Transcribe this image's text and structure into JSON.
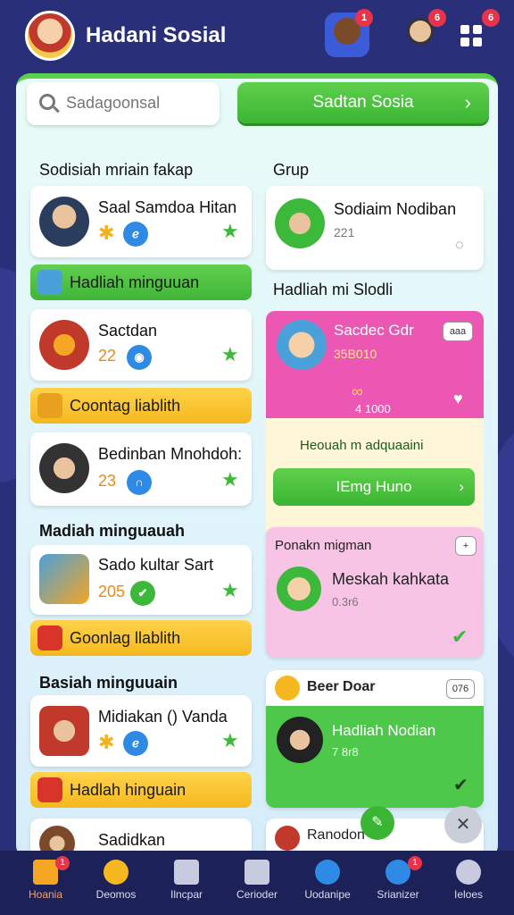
{
  "header": {
    "title": "Hadani Sosial",
    "icons": [
      {
        "name": "friends-icon",
        "badge": "1"
      },
      {
        "name": "profile-icon",
        "badge": "6"
      },
      {
        "name": "grid-menu-icon",
        "badge": "6"
      }
    ]
  },
  "search": {
    "placeholder": "Sadagoonsal"
  },
  "primary_button": {
    "label": "Sadtan Sosia"
  },
  "left": {
    "section_title": "Sodisiah mriain fakap",
    "cards": [
      {
        "name": "Saal Samdoa Hitan",
        "num": ""
      },
      {
        "name": "Sactdan",
        "num": "22"
      },
      {
        "name": "Bedinban Mnohdoh:",
        "num": "23"
      },
      {
        "name": "Sado kultar Sart",
        "num": "205"
      },
      {
        "name": "Midiakan () Vanda",
        "num": ""
      },
      {
        "name": "Sadidkan",
        "num": ""
      }
    ],
    "bars": [
      {
        "label": "Hadliah minguuan",
        "color": "green"
      },
      {
        "label": "Coontag liablith",
        "color": "yellow"
      },
      {
        "label": "Goonlag llablith",
        "color": "yellow"
      },
      {
        "label": "Hadlah hinguain",
        "color": "yellow"
      }
    ],
    "sub_titles": [
      "Madiah minguauah",
      "Basiah minguuain"
    ]
  },
  "right": {
    "section_title": "Grup",
    "group_card": {
      "name": "Sodiaim Nodiban",
      "num": "221"
    },
    "sub_title": "Hadliah mi Slodli",
    "pink_card": {
      "title": "Sacdec Gdr",
      "value": "35B010",
      "amount": "4 1000",
      "tag": "aaa",
      "lower_text": "Heouah m adquaaini",
      "button": "IEmg Huno"
    },
    "lpink_card": {
      "title": "Ponakn migman",
      "name": "Meskah kahkata",
      "sub": "0.3r6",
      "tag": "+"
    },
    "green_card": {
      "header": "Beer Doar",
      "tag": "076",
      "name": "Hadliah Nodian",
      "sub": "7 8r8"
    },
    "bottom_card": {
      "name": "Ranodon"
    }
  },
  "nav": [
    {
      "label": "Hoania",
      "badge": "1",
      "color": "#f5a623"
    },
    {
      "label": "Deomos",
      "badge": "",
      "color": "#f5b81e"
    },
    {
      "label": "Ilncpar",
      "badge": "",
      "color": "#c8cbe0"
    },
    {
      "label": "Cerioder",
      "badge": "",
      "color": "#c8cbe0"
    },
    {
      "label": "Uodanipe",
      "badge": "",
      "color": "#2f8ae6"
    },
    {
      "label": "Srianizer",
      "badge": "1",
      "color": "#2f8ae6"
    },
    {
      "label": "Ieloes",
      "badge": "",
      "color": "#c8cbe0"
    }
  ]
}
